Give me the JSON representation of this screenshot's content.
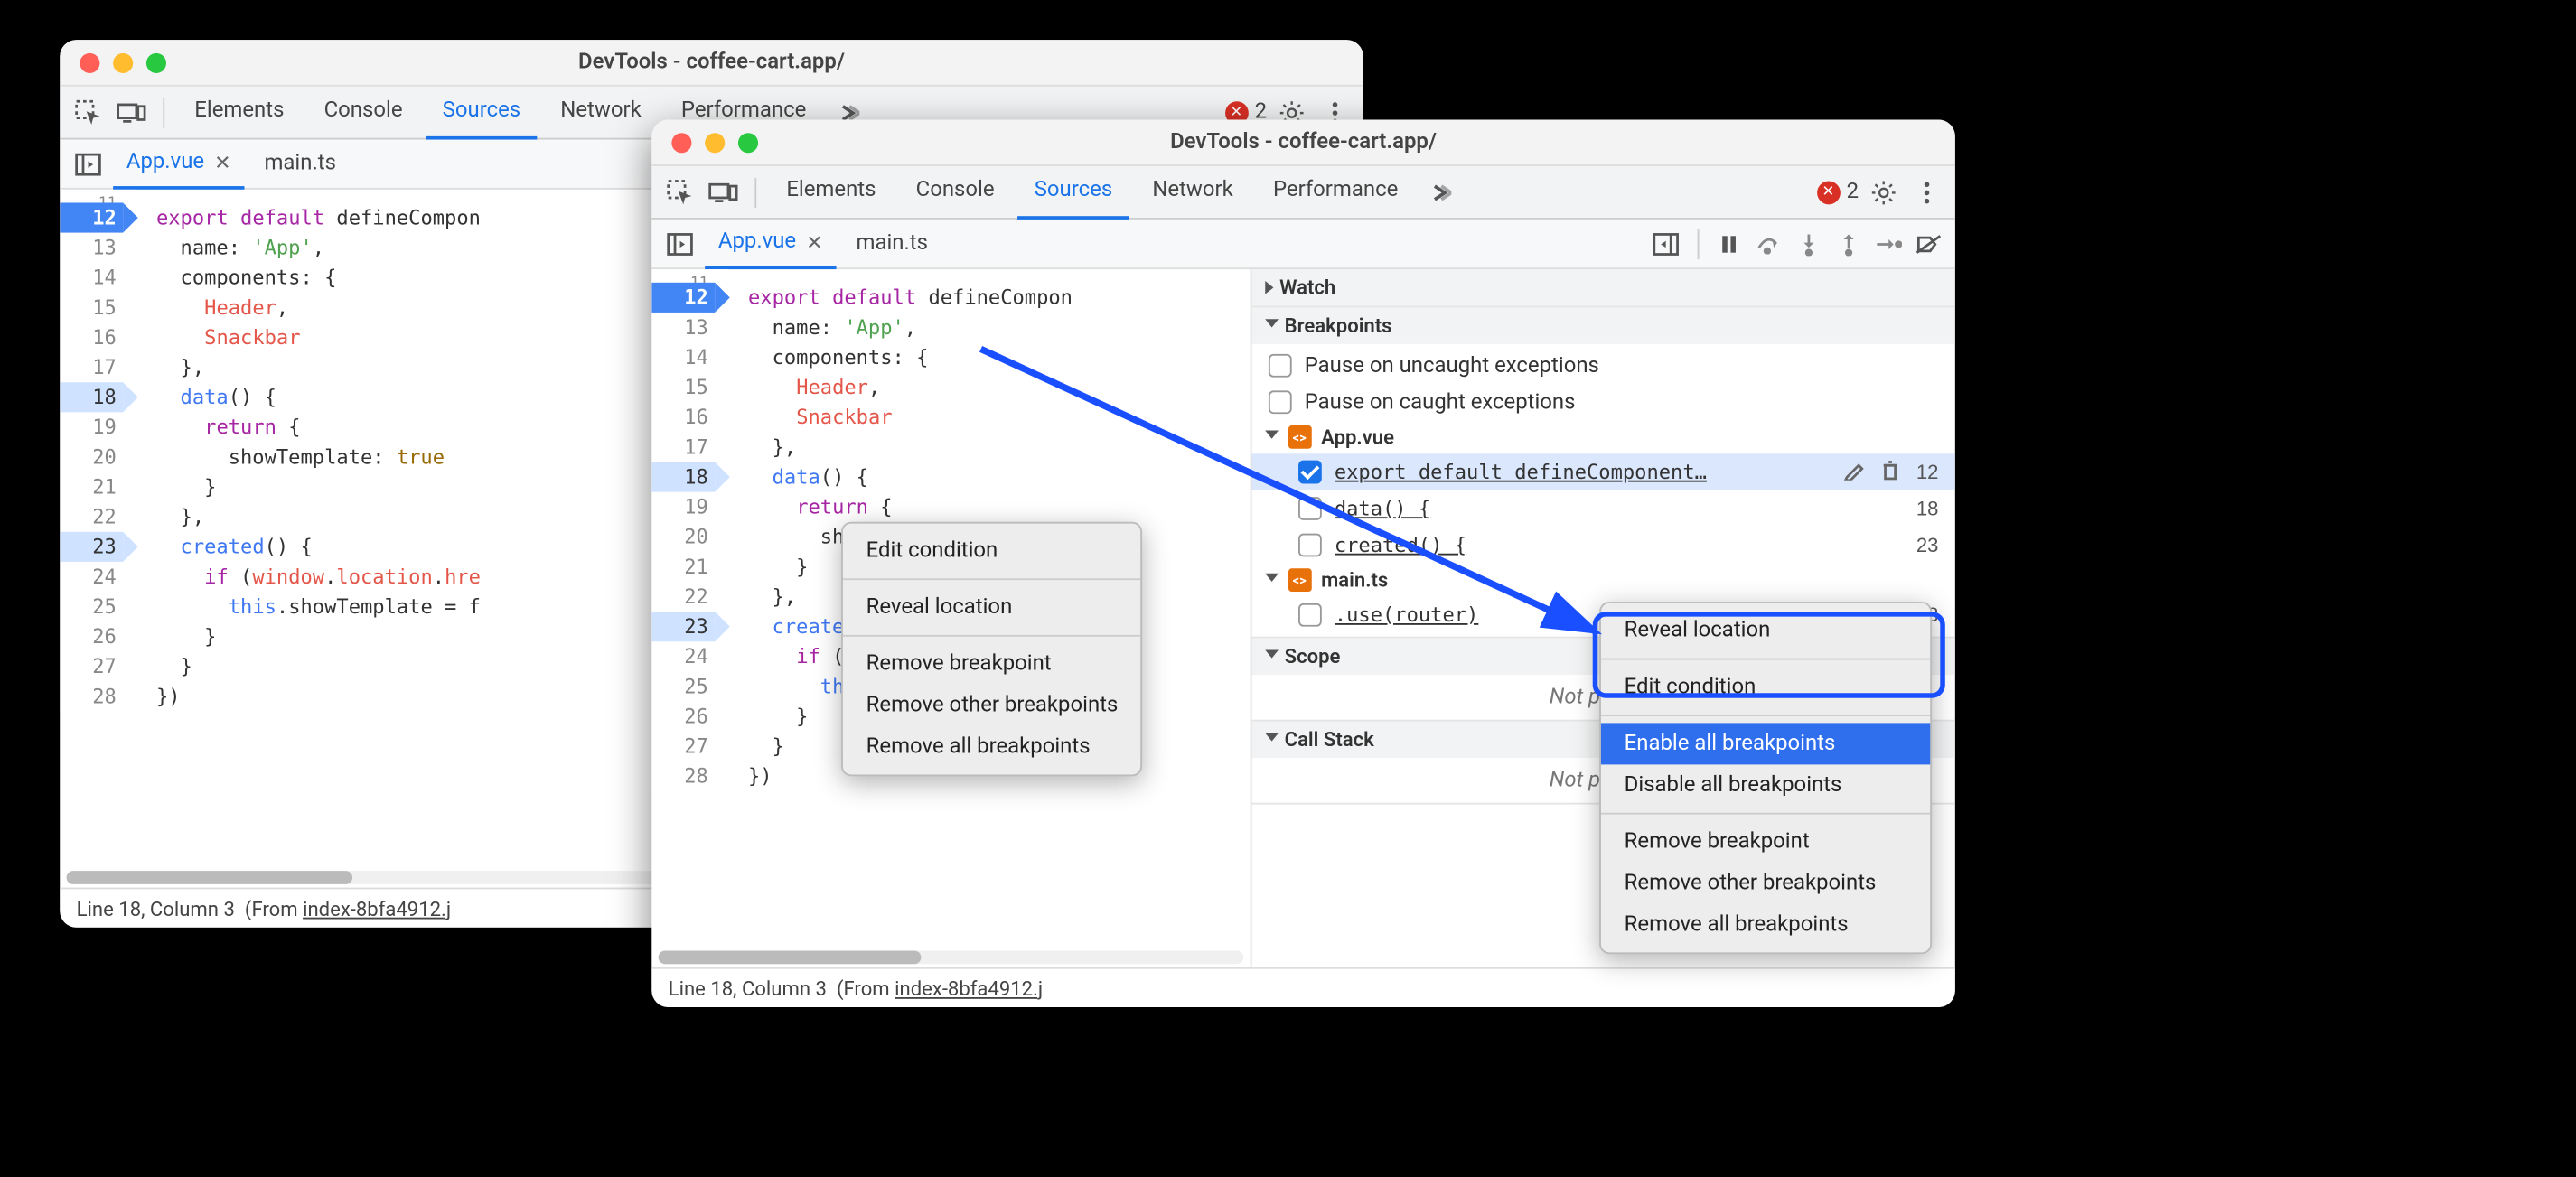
{
  "windows": {
    "left": {
      "title": "DevTools - coffee-cart.app/",
      "tabs": [
        "Elements",
        "Console",
        "Sources",
        "Network",
        "Performance"
      ],
      "active_tab": "Sources",
      "error_count": "2",
      "files": {
        "active": "App.vue",
        "other": "main.ts"
      },
      "code": {
        "first_line_fragment": "11",
        "lines": [
          {
            "n": "12",
            "bp": true,
            "html": "<span class='kw'>export</span> <span class='kw'>default</span> defineCompon"
          },
          {
            "n": "13",
            "html": "  name: <span class='str'>'App'</span>,"
          },
          {
            "n": "14",
            "html": "  components: {"
          },
          {
            "n": "15",
            "html": "    <span class='var'>Header</span>,"
          },
          {
            "n": "16",
            "html": "    <span class='var'>Snackbar</span>"
          },
          {
            "n": "17",
            "html": "  },"
          },
          {
            "n": "18",
            "hi": true,
            "html": "  <span class='fn'>data</span>() {"
          },
          {
            "n": "19",
            "html": "    <span class='kw'>return</span> {"
          },
          {
            "n": "20",
            "html": "      showTemplate: <span class='lit'>true</span>"
          },
          {
            "n": "21",
            "html": "    }"
          },
          {
            "n": "22",
            "html": "  },"
          },
          {
            "n": "23",
            "hi": true,
            "html": "  <span class='fn'>created</span>() {"
          },
          {
            "n": "24",
            "html": "    <span class='kw'>if</span> (<span class='var'>window</span>.<span class='var'>location</span>.<span class='var'>hre</span>"
          },
          {
            "n": "25",
            "html": "      <span class='this'>this</span>.showTemplate = f"
          },
          {
            "n": "26",
            "html": "    }"
          },
          {
            "n": "27",
            "html": "  }"
          },
          {
            "n": "28",
            "html": "})"
          }
        ]
      },
      "debug": {
        "watch": "Watch",
        "breakpoints": "Breakpoints",
        "pause_uncaught": "Pause on uncaught exceptions",
        "pause_caught": "Pause on caught exceptions",
        "groups": [
          {
            "name": "App.vue",
            "items": [
              {
                "label": "export default defineComponent",
                "checked": true,
                "sel": true,
                "ln": ""
              },
              {
                "label": "data() {",
                "checked": false,
                "ln": ""
              },
              {
                "label": "created() {",
                "checked": false,
                "ln": ""
              }
            ]
          },
          {
            "name": "main.ts",
            "items": [
              {
                "label": ".use(router)",
                "checked": false,
                "ln": ""
              }
            ]
          }
        ],
        "scope": "Scope",
        "not_paused": "Not paused",
        "call_stack": "Call Stack"
      },
      "status": {
        "pos": "Line 18, Column 3",
        "from_label": "(From ",
        "from_file": "index-8bfa4912.j"
      },
      "ctx": {
        "items": [
          {
            "t": "Edit condition"
          },
          {
            "sep": true
          },
          {
            "t": "Reveal location"
          },
          {
            "sep": true
          },
          {
            "t": "Remove breakpoint"
          },
          {
            "t": "Remove other breakpoints"
          },
          {
            "t": "Remove all breakpoints"
          }
        ]
      }
    },
    "right": {
      "title": "DevTools - coffee-cart.app/",
      "tabs": [
        "Elements",
        "Console",
        "Sources",
        "Network",
        "Performance"
      ],
      "active_tab": "Sources",
      "error_count": "2",
      "files": {
        "active": "App.vue",
        "other": "main.ts"
      },
      "debug": {
        "watch": "Watch",
        "breakpoints": "Breakpoints",
        "pause_uncaught": "Pause on uncaught exceptions",
        "pause_caught": "Pause on caught exceptions",
        "groups": [
          {
            "name": "App.vue",
            "items": [
              {
                "label": "export default defineComponent…",
                "checked": true,
                "sel": true,
                "ln": "12",
                "editdel": true
              },
              {
                "label": "data() {",
                "checked": false,
                "ln": "18"
              },
              {
                "label": "created() {",
                "checked": false,
                "ln": "23"
              }
            ]
          },
          {
            "name": "main.ts",
            "items": [
              {
                "label": ".use(router)",
                "checked": false,
                "ln": "8"
              }
            ]
          }
        ],
        "scope": "Scope",
        "not_paused": "Not paused",
        "call_stack": "Call Stack"
      },
      "status": {
        "pos": "Line 18, Column 3",
        "from_label": "(From ",
        "from_file": "index-8bfa4912.j"
      },
      "ctx": {
        "items": [
          {
            "t": "Reveal location"
          },
          {
            "sep": true
          },
          {
            "t": "Edit condition"
          },
          {
            "sep": true
          },
          {
            "t": "Enable all breakpoints",
            "sel": true
          },
          {
            "t": "Disable all breakpoints"
          },
          {
            "sep": true
          },
          {
            "t": "Remove breakpoint"
          },
          {
            "t": "Remove other breakpoints"
          },
          {
            "t": "Remove all breakpoints"
          }
        ]
      }
    }
  }
}
